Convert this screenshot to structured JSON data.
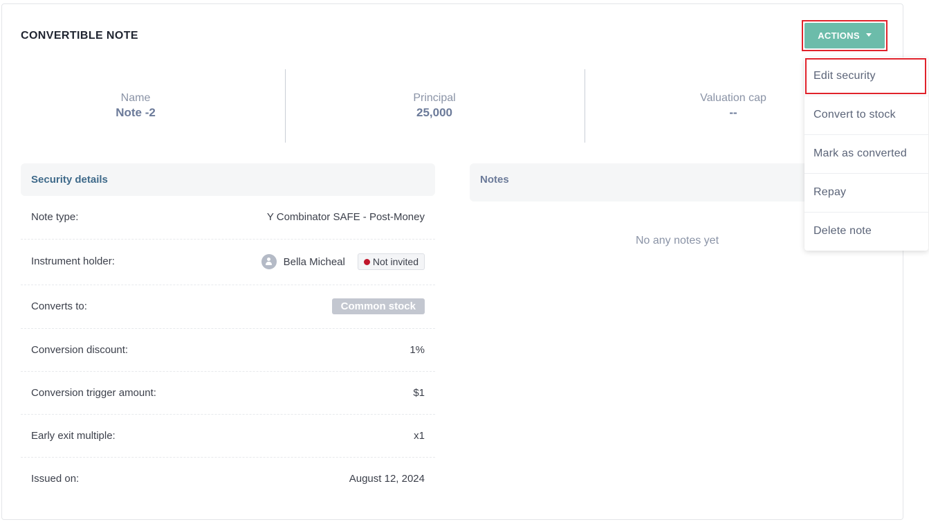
{
  "header": {
    "title": "CONVERTIBLE NOTE",
    "actions_label": "ACTIONS"
  },
  "stats": [
    {
      "label": "Name",
      "value": "Note -2"
    },
    {
      "label": "Principal",
      "value": "25,000"
    },
    {
      "label": "Valuation cap",
      "value": "--"
    }
  ],
  "security_details": {
    "heading": "Security details",
    "note_type_label": "Note type:",
    "note_type_value": "Y Combinator SAFE - Post-Money",
    "holder_label": "Instrument holder:",
    "holder_name": "Bella Micheal",
    "holder_status": "Not invited",
    "converts_to_label": "Converts to:",
    "converts_to_value": "Common stock",
    "discount_label": "Conversion discount:",
    "discount_value": "1%",
    "trigger_label": "Conversion trigger amount:",
    "trigger_value": "$1",
    "exit_label": "Early exit multiple:",
    "exit_value": "x1",
    "issued_label": "Issued on:",
    "issued_value": "August 12, 2024"
  },
  "notes": {
    "heading": "Notes",
    "empty_text": "No any notes yet"
  },
  "actions_menu": {
    "items": [
      "Edit security",
      "Convert to stock",
      "Mark as converted",
      "Repay",
      "Delete note"
    ]
  },
  "colors": {
    "actions_button": "#6cbcaa",
    "highlight_border": "#e0222b",
    "status_dot": "#c0152a",
    "section_heading": "#3f6a8a"
  },
  "icons": {
    "actions_caret": "caret-down-icon",
    "holder_avatar": "user-avatar-icon",
    "status_dot": "status-dot-icon"
  }
}
